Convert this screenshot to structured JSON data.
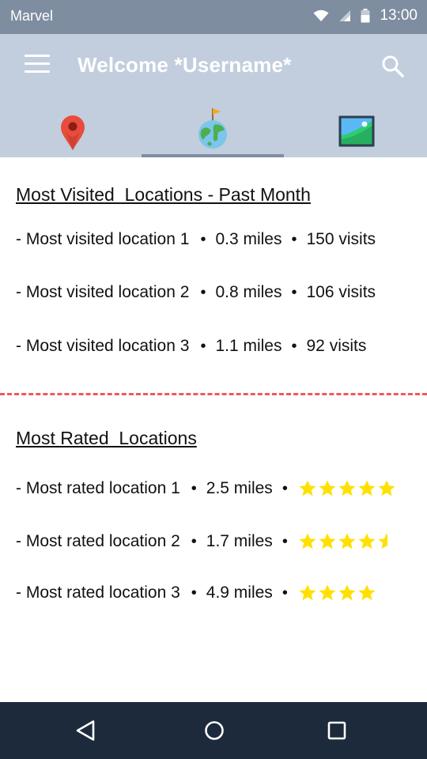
{
  "status_bar": {
    "carrier": "Marvel",
    "time": "13:00",
    "icons": [
      "wifi-icon",
      "signal-icon",
      "battery-icon"
    ]
  },
  "app_bar": {
    "title": "Welcome *Username*",
    "menu_icon": "menu-icon",
    "search_icon": "search-icon"
  },
  "tabs": [
    {
      "icon": "map-pin-icon",
      "selected": false
    },
    {
      "icon": "globe-flag-icon",
      "selected": true
    },
    {
      "icon": "image-icon",
      "selected": false
    }
  ],
  "most_visited": {
    "title": "Most Visited  Locations - Past Month",
    "items": [
      {
        "name": "- Most visited location 1",
        "distance": "0.3 miles",
        "visits": "150 visits"
      },
      {
        "name": "- Most visited location 2",
        "distance": "0.8 miles",
        "visits": "106 visits"
      },
      {
        "name": "- Most visited location 3",
        "distance": "1.1 miles",
        "visits": "92 visits"
      }
    ]
  },
  "most_rated": {
    "title": "Most Rated  Locations",
    "items": [
      {
        "name": "- Most rated location 1",
        "distance": "2.5 miles",
        "rating": 5
      },
      {
        "name": "- Most rated location 2",
        "distance": "1.7 miles",
        "rating": 4.5
      },
      {
        "name": "- Most rated location 3",
        "distance": "4.9 miles",
        "rating": 4
      }
    ]
  },
  "bullet": "•",
  "nav_bar": {
    "icons": [
      "back-icon",
      "home-icon",
      "recents-icon"
    ]
  },
  "colors": {
    "status_bar": "#7f8da0",
    "app_bar": "#c2cedd",
    "divider": "#ee5a5a",
    "star": "#ffe000",
    "nav_bar": "#1d2a3b"
  }
}
